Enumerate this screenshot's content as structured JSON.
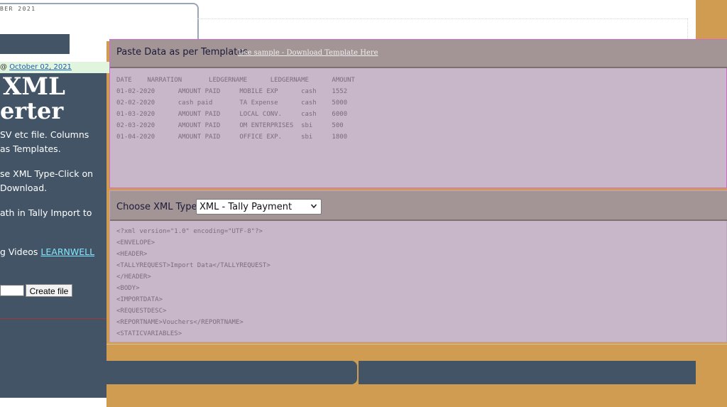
{
  "header": {
    "date_fragment": "BER 2021",
    "posted_prefix": "@ ",
    "posted_date": "October 02, 2021"
  },
  "sidebar": {
    "title_line1": "XML",
    "title_line2": "erter",
    "lines": [
      "SV etc file. Columns",
      "as Templates.",
      "se XML Type-Click on",
      "Download.",
      "ath in Tally Import to"
    ],
    "videos_prefix": "g Videos ",
    "videos_link": "LEARNWELL",
    "create_button": "Create file"
  },
  "paste_section": {
    "title": "Paste Data as per Templates",
    "sample_link": "Use sample - Download Template Here",
    "data_text": "DATE    NARRATION       LEDGERNAME      LEDGERNAME      AMOUNT\n01-02-2020      AMOUNT PAID     MOBILE EXP      cash    1552\n02-02-2020      cash paid       TA Expense      cash    5000\n01-03-2020      AMOUNT PAID     LOCAL CONV.     cash    6000\n02-03-2020      AMOUNT PAID     OM ENTERPRISES  sbi     500\n01-04-2020      AMOUNT PAID     OFFICE EXP.     sbi     1800"
  },
  "xml_section": {
    "label": "Choose XML Type - ",
    "selected_type": "XML - Tally Payment",
    "xml_text": "<?xml version=\"1.0\" encoding=\"UTF-8\"?>\n<ENVELOPE>\n<HEADER>\n<TALLYREQUEST>Import Data</TALLYREQUEST>\n</HEADER>\n<BODY>\n<IMPORTDATA>\n<REQUESTDESC>\n<REPORTNAME>Vouchers</REPORTNAME>\n<STATICVARIABLES>"
  },
  "colors": {
    "slate": "#425466",
    "gold": "#cf9c52",
    "panel": "#c8b6c9",
    "panel_header": "#a39596",
    "link_cyan": "#7fe7ff"
  }
}
